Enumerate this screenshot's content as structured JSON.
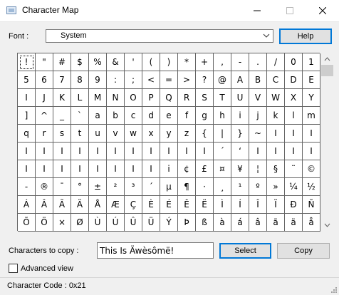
{
  "window": {
    "title": "Character Map",
    "controls": [
      "minimize-icon",
      "maximize-icon",
      "close-icon"
    ]
  },
  "font": {
    "label": "Font :",
    "value": "System",
    "help_label": "Help"
  },
  "grid": {
    "rows": [
      [
        "!",
        "\"",
        "#",
        "$",
        "%",
        "&",
        "'",
        "(",
        ")",
        "*",
        "+",
        ",",
        "-",
        ".",
        "/",
        "0",
        "1"
      ],
      [
        "5",
        "6",
        "7",
        "8",
        "9",
        ":",
        ";",
        "<",
        "=",
        ">",
        "?",
        "@",
        "A",
        "B",
        "C",
        "D",
        "E"
      ],
      [
        "I",
        "J",
        "K",
        "L",
        "M",
        "N",
        "O",
        "P",
        "Q",
        "R",
        "S",
        "T",
        "U",
        "V",
        "W",
        "X",
        "Y"
      ],
      [
        "]",
        "^",
        "_",
        "`",
        "a",
        "b",
        "c",
        "d",
        "e",
        "f",
        "g",
        "h",
        "i",
        "j",
        "k",
        "l",
        "m"
      ],
      [
        "q",
        "r",
        "s",
        "t",
        "u",
        "v",
        "w",
        "x",
        "y",
        "z",
        "{",
        "|",
        "}",
        "~",
        "I",
        "I",
        "I"
      ],
      [
        "I",
        "I",
        "I",
        "I",
        "I",
        "I",
        "I",
        "I",
        "I",
        "I",
        "I",
        "´",
        "‘",
        "I",
        "I",
        "I",
        "I"
      ],
      [
        "I",
        "I",
        "I",
        "I",
        "I",
        "I",
        "I",
        "I",
        "i",
        "¢",
        "£",
        "¤",
        "¥",
        "¦",
        "§",
        "¨",
        "©"
      ],
      [
        "-",
        "®",
        "¯",
        "°",
        "±",
        "²",
        "³",
        "´",
        "µ",
        "¶",
        "·",
        "¸",
        "¹",
        "º",
        "»",
        "¼",
        "½"
      ],
      [
        "Á",
        "Â",
        "Ã",
        "Ä",
        "Å",
        "Æ",
        "Ç",
        "È",
        "É",
        "Ê",
        "Ë",
        "Ì",
        "Í",
        "Î",
        "Ï",
        "Ð",
        "Ñ"
      ],
      [
        "Õ",
        "Ö",
        "×",
        "Ø",
        "Ù",
        "Ú",
        "Û",
        "Ü",
        "Ý",
        "Þ",
        "ß",
        "à",
        "á",
        "â",
        "ã",
        "ä",
        "å"
      ]
    ],
    "selected_row": 0,
    "selected_col": 0
  },
  "copy": {
    "label": "Characters to copy :",
    "value": "This Is Äwèsômë!",
    "select_label": "Select",
    "copy_label": "Copy"
  },
  "advanced": {
    "label": "Advanced view",
    "checked": false
  },
  "status": {
    "text": "Character Code : 0x21"
  }
}
